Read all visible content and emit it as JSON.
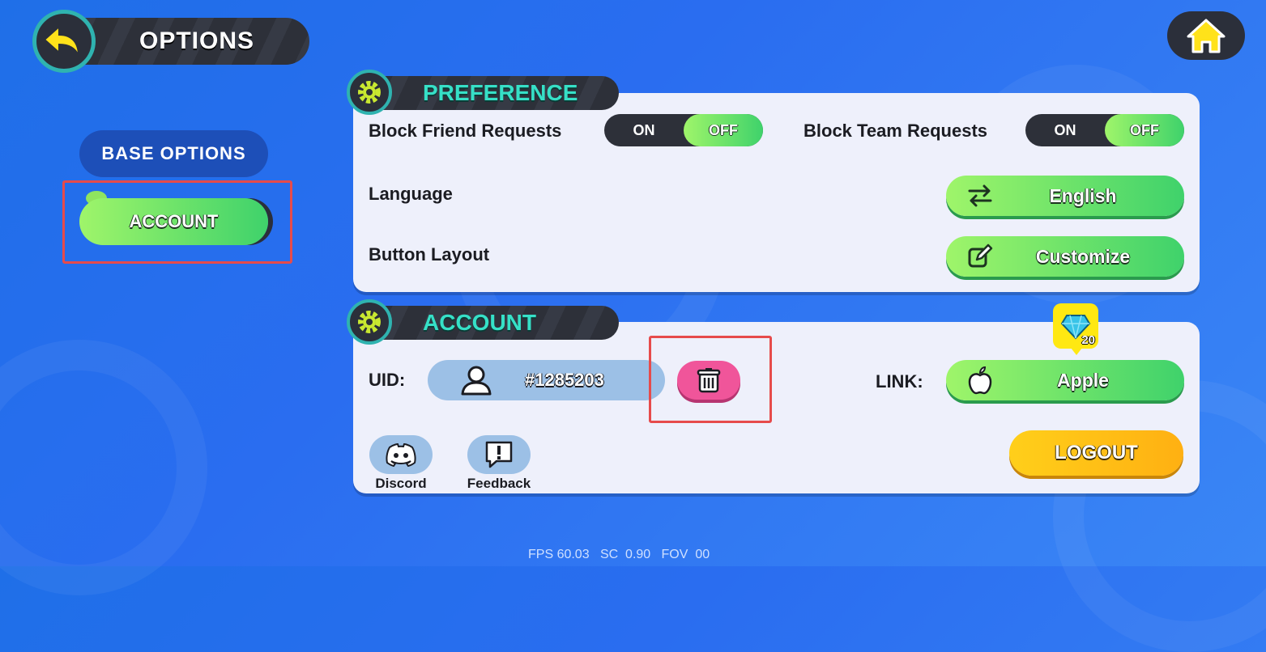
{
  "header": {
    "title": "OPTIONS"
  },
  "tabs": [
    {
      "label": "BASE OPTIONS"
    },
    {
      "label": "ACCOUNT"
    }
  ],
  "preference": {
    "title": "PREFERENCE",
    "block_friend": {
      "label": "Block Friend Requests",
      "on": "ON",
      "off": "OFF",
      "selected": "OFF"
    },
    "block_team": {
      "label": "Block Team Requests",
      "on": "ON",
      "off": "OFF",
      "selected": "OFF"
    },
    "language": {
      "label": "Language",
      "value": "English"
    },
    "button_layout": {
      "label": "Button Layout",
      "value": "Customize"
    }
  },
  "account": {
    "title": "ACCOUNT",
    "uid_label": "UID:",
    "uid": "#1285203",
    "link_label": "LINK:",
    "link_value": "Apple",
    "gem_reward": "20",
    "logout": "LOGOUT",
    "discord": "Discord",
    "feedback": "Feedback"
  },
  "debug": {
    "text": "FPS 60.03   SC  0.90   FOV  00"
  },
  "colors": {
    "accent_green": "#3fd26b",
    "teal": "#36e0c7",
    "highlight": "#e64b4b",
    "logout": "#ffb012"
  }
}
